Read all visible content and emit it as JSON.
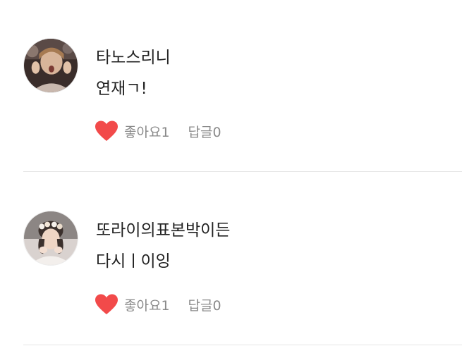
{
  "comments": [
    {
      "nickname": "타노스리니",
      "content": "연재ㄱ!",
      "like_label": "좋아요1",
      "reply_label": "답글0",
      "avatar_icon": "user-avatar-photo"
    },
    {
      "nickname": "또라이의표본박이든",
      "content": "다시ㅣ이잉",
      "like_label": "좋아요1",
      "reply_label": "답글0",
      "avatar_icon": "user-avatar-photo"
    }
  ],
  "colors": {
    "heart": "#f24a4a",
    "text_primary": "#222222",
    "text_secondary": "#8a8a8a",
    "divider": "#e5e5e5"
  }
}
